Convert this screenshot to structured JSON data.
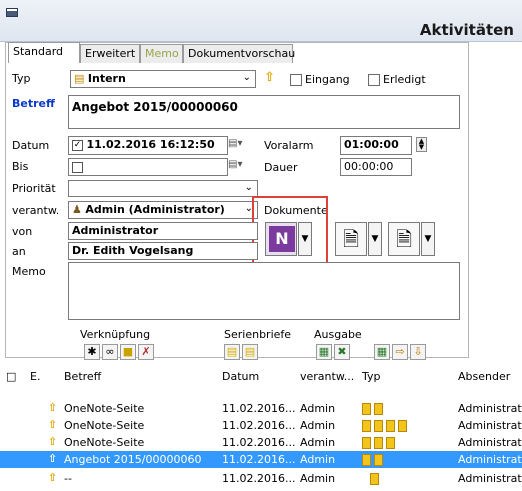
{
  "window": {
    "title": "Aktivitäten"
  },
  "tabs": [
    "Standard",
    "Erweitert",
    "Memo",
    "Dokumentvorschau"
  ],
  "form": {
    "typ_label": "Typ",
    "typ_value": "Intern",
    "eingang_label": "Eingang",
    "erledigt_label": "Erledigt",
    "betreff_label": "Betreff",
    "betreff_value": "Angebot 2015/00000060",
    "datum_label": "Datum",
    "datum_value": "11.02.2016 16:12:50",
    "voralarm_label": "Voralarm",
    "voralarm_value": "01:00:00",
    "bis_label": "Bis",
    "dauer_label": "Dauer",
    "dauer_value": "00:00:00",
    "prioritaet_label": "Priorität",
    "verantw_label": "verantw.",
    "verantw_value": "Admin (Administrator)",
    "dokumente_label": "Dokumente",
    "von_label": "von",
    "von_value": "Administrator",
    "an_label": "an",
    "an_value": "Dr. Edith Vogelsang",
    "memo_label": "Memo"
  },
  "toolbar": {
    "verknuepfung_label": "Verknüpfung",
    "serienbriefe_label": "Serienbriefe",
    "ausgabe_label": "Ausgabe"
  },
  "grid": {
    "headers": [
      "E.",
      "Betreff",
      "Datum",
      "verantw...",
      "Typ",
      "Absender"
    ],
    "rows": [
      {
        "betreff": "OneNote-Seite",
        "datum": "11.02.2016...",
        "verantw": "Admin",
        "absender": "Administrato"
      },
      {
        "betreff": "OneNote-Seite",
        "datum": "11.02.2016...",
        "verantw": "Admin",
        "absender": "Administrato"
      },
      {
        "betreff": "OneNote-Seite",
        "datum": "11.02.2016...",
        "verantw": "Admin",
        "absender": "Administrato"
      },
      {
        "betreff": "Angebot 2015/00000060",
        "datum": "11.02.2016...",
        "verantw": "Admin",
        "absender": "Administrato"
      },
      {
        "betreff": "--",
        "datum": "11.02.2016...",
        "verantw": "Admin",
        "absender": "Administrato"
      }
    ]
  },
  "colors": {
    "selection": "#3399ff",
    "highlight_box": "#e0403a",
    "betreff_label": "#0a3ac8"
  }
}
